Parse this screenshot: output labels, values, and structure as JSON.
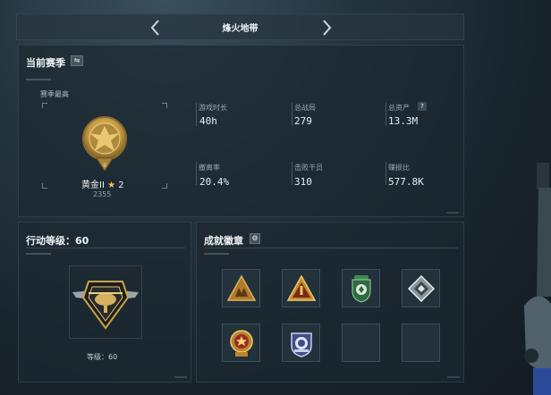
{
  "header": {
    "title": "烽火地带"
  },
  "season": {
    "title": "当前赛季",
    "best_label": "赛季最高",
    "rank_name": "黄金II",
    "rank_star_icon": "star-icon",
    "rank_stars": "2",
    "rank_points": "2355",
    "stats": [
      {
        "label": "游戏时长",
        "value": "40h"
      },
      {
        "label": "总战局",
        "value": "279"
      },
      {
        "label": "总资产",
        "value": "13.3M"
      },
      {
        "label": "撤离率",
        "value": "20.4%"
      },
      {
        "label": "击败干员",
        "value": "310"
      },
      {
        "label": "赚损比",
        "value": "577.8K"
      }
    ],
    "help_glyph": "?"
  },
  "action_level": {
    "title": "行动等级：60",
    "level_text": "等级：60"
  },
  "achievements": {
    "title": "成就徽章",
    "badges": [
      "triangle-badge-figures",
      "triangle-badge-one",
      "shield-badge-green",
      "diamond-badge-silver",
      "medal-badge-red",
      "shield-badge-blue",
      "empty-slot",
      "empty-slot"
    ]
  },
  "colors": {
    "gold": "#c9a24a",
    "star": "#f2c94c",
    "panel": "#1c2830"
  }
}
